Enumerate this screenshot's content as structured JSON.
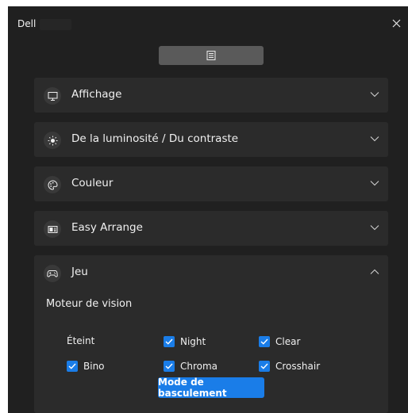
{
  "window": {
    "app_name": "Dell",
    "close_icon": "close-icon",
    "toggle_icon": "menu-lines-icon"
  },
  "sections": [
    {
      "label": "Affichage",
      "icon": "monitor-icon",
      "expanded": false
    },
    {
      "label": "De la luminosité / Du contraste",
      "icon": "brightness-icon",
      "expanded": false
    },
    {
      "label": "Couleur",
      "icon": "palette-icon",
      "expanded": false
    },
    {
      "label": "Easy Arrange",
      "icon": "layout-icon",
      "expanded": false
    },
    {
      "label": "Jeu",
      "icon": "gamepad-icon",
      "expanded": true
    }
  ],
  "game": {
    "subtitle": "Moteur de vision",
    "off_label": "Éteint",
    "options": [
      {
        "label": "Night",
        "checked": true
      },
      {
        "label": "Clear",
        "checked": true
      },
      {
        "label": "Bino",
        "checked": true
      },
      {
        "label": "Chroma",
        "checked": true
      },
      {
        "label": "Crosshair",
        "checked": true
      }
    ],
    "toggle_button": "Mode de basculement"
  },
  "colors": {
    "background": "#202020",
    "panel": "#2b2b2b",
    "accent": "#1a7de8"
  }
}
